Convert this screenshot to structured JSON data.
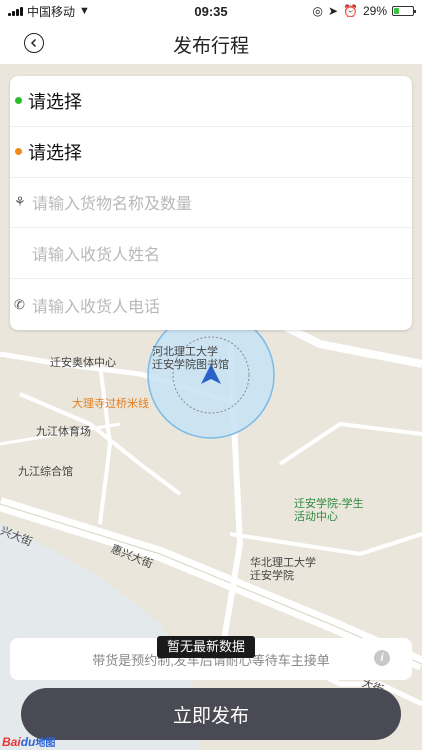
{
  "status_bar": {
    "carrier": "中国移动",
    "time": "09:35",
    "battery": "29%",
    "battery_level": 0.29
  },
  "nav": {
    "title": "发布行程",
    "back_icon": "back-circle-icon"
  },
  "form": {
    "origin_value": "请选择",
    "origin_dot_color": "#2bbb2b",
    "destination_value": "请选择",
    "destination_dot_color": "#f08a1c",
    "cargo_placeholder": "请输入货物名称及数量",
    "receiver_name_placeholder": "请输入收货人姓名",
    "receiver_phone_placeholder": "请输入收货人电话"
  },
  "map": {
    "labels": {
      "uni_library": "河北理工大学\n迁安学院图书馆",
      "sports_center": "迁安奥体中心",
      "bridge": "大理寺过桥米线",
      "jiujiang_stadium": "九江体育场",
      "jiujiang_complex": "九江综合馆",
      "student_center": "迁安学院-学生\n活动中心",
      "huabei_uni": "华北理工大学\n迁安学院",
      "huixing_street": "惠兴大街",
      "xing_street": "兴大街",
      "da_street": "大街"
    },
    "logo_bai": "Bai",
    "logo_du": "du",
    "logo_suffix": "地图"
  },
  "notice": {
    "text": "带货是预约制,发车后请耐心等待车主接单",
    "toast": "暂无最新数据"
  },
  "publish_button": "立即发布",
  "colors": {
    "primary_button": "#4a4a55",
    "location_circle": "#7cbbe8",
    "location_arrow": "#2a62c9"
  }
}
